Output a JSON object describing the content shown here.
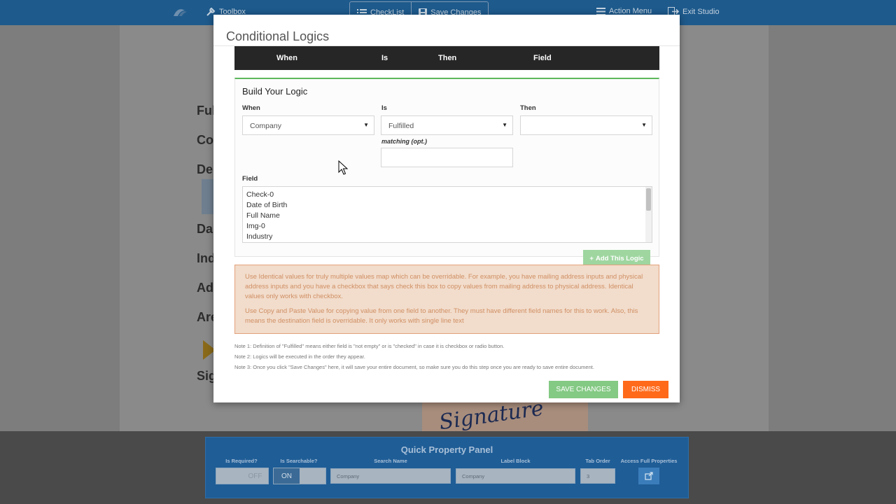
{
  "topbar": {
    "toolbox_label": "Toolbox",
    "checklist_label": "CheckList",
    "save_label": "Save Changes",
    "action_menu_label": "Action Menu",
    "exit_label": "Exit Studio"
  },
  "background_doc": {
    "labels": [
      "Ful",
      "Co",
      "De",
      "Da",
      "Ind",
      "Ad",
      "Are",
      "Sig"
    ],
    "signature_text": "Signature"
  },
  "modal": {
    "title": "Conditional Logics",
    "table_headers": {
      "when": "When",
      "is": "Is",
      "then": "Then",
      "field": "Field"
    },
    "builder": {
      "heading": "Build Your Logic",
      "when_label": "When",
      "when_value": "Company",
      "is_label": "Is",
      "is_value": "Fulfilled",
      "then_label": "Then",
      "then_value": "",
      "matching_label": "matching (opt.)",
      "matching_value": "",
      "field_label": "Field",
      "field_options": [
        "Check-0",
        "Date of Birth",
        "Full Name",
        "Img-0",
        "Industry"
      ]
    },
    "add_logic_label": "Add This Logic",
    "warning": {
      "p1": "Use Identical values for truly multiple values map which can be overridable. For example, you have mailing address inputs and physical address inputs and you have a checkbox that says check this box to copy values from mailing address to physical address. Identical values only works with checkbox.",
      "p2": "Use Copy and Paste Value for copying value from one field to another. They must have different field names for this to work. Also, this means the destination field is overridable. It only works with single line text"
    },
    "notes": [
      "Note 1: Definition of \"Fulfilled\" means either field is \"not empty\" or is \"checked\" in case it is checkbox or radio button.",
      "Note 2: Logics will be executed in the order they appear.",
      "Note 3: Once you click \"Save Changes\" here, it will save your entire document, so make sure you do this step once you are ready to save entire document."
    ],
    "save_button": "SAVE CHANGES",
    "dismiss_button": "DISMISS"
  },
  "quick_panel": {
    "title": "Quick Property Panel",
    "required_label": "Is Required?",
    "required_off": "OFF",
    "searchable_label": "Is Searchable?",
    "searchable_on": "ON",
    "search_name_label": "Search Name",
    "search_name_value": "Company",
    "label_block_label": "Label Block",
    "label_block_value": "Company",
    "tab_order_label": "Tab Order",
    "tab_order_value": "3",
    "full_props_label": "Access Full Properties"
  }
}
